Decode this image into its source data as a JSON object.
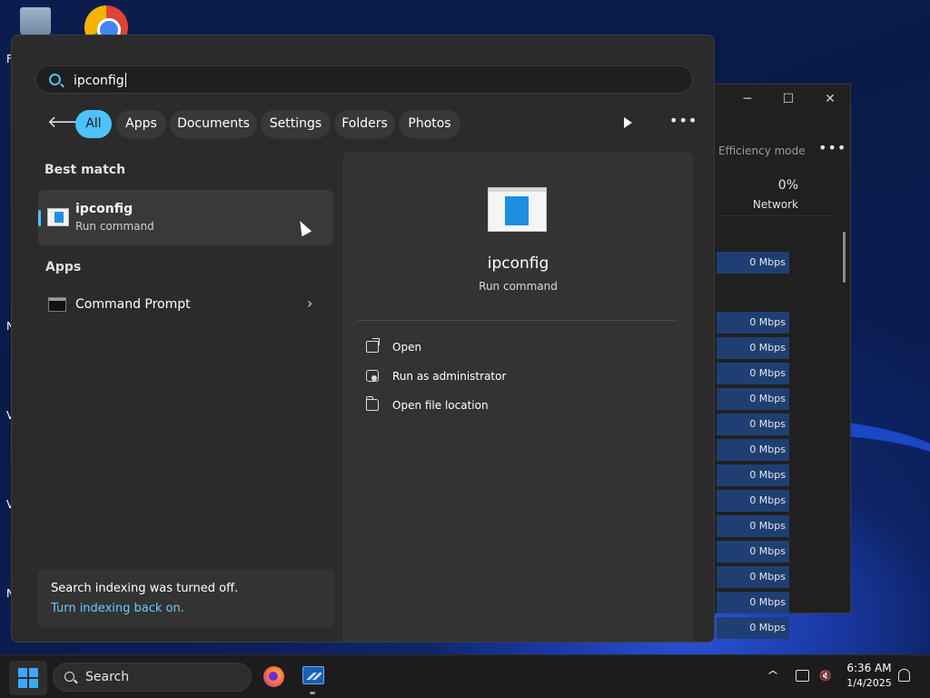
{
  "search": {
    "query": "ipconfig"
  },
  "filters": [
    "All",
    "Apps",
    "Documents",
    "Settings",
    "Folders",
    "Photos"
  ],
  "best_match": {
    "section_title": "Best match",
    "name": "ipconfig",
    "subtitle": "Run command"
  },
  "apps": {
    "section_title": "Apps",
    "items": [
      {
        "label": "Command Prompt"
      }
    ]
  },
  "indexing": {
    "message": "Search indexing was turned off.",
    "link": "Turn indexing back on."
  },
  "preview": {
    "title": "ipconfig",
    "subtitle": "Run command",
    "actions": [
      "Open",
      "Run as administrator",
      "Open file location"
    ]
  },
  "taskmgr": {
    "efficiency_mode": "Efficiency mode",
    "network_pct": "0%",
    "network_label": "Network",
    "rows": [
      "0 Mbps",
      "0 Mbps",
      "0 Mbps",
      "0 Mbps",
      "0 Mbps",
      "0 Mbps",
      "0 Mbps",
      "0 Mbps",
      "0 Mbps",
      "0 Mbps",
      "0 Mbps",
      "0 Mbps",
      "0 Mbps",
      "0 Mbps"
    ]
  },
  "taskbar": {
    "search_label": "Search",
    "time": "6:36 AM",
    "date": "1/4/2025"
  },
  "colors": {
    "accent": "#4cc2ff",
    "panel": "#2b2b2b",
    "taskbar": "#1c1c1c"
  }
}
